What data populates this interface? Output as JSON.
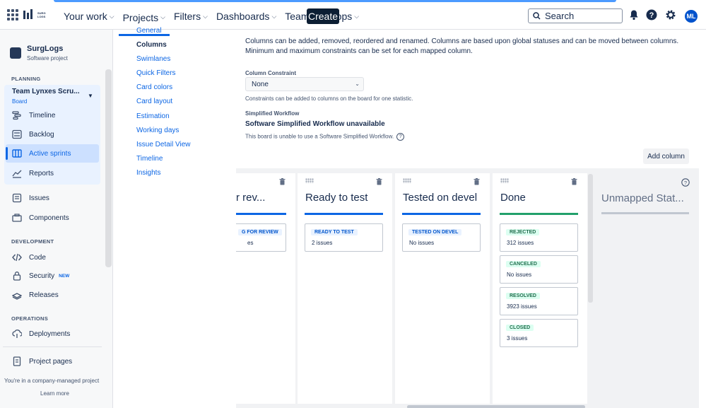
{
  "topnav": {
    "logo_text": "SURG LOGS",
    "items": [
      {
        "label": "Your work"
      },
      {
        "label": "Projects"
      },
      {
        "label": "Filters"
      },
      {
        "label": "Dashboards"
      },
      {
        "label": "Teams"
      },
      {
        "label": "Apps"
      }
    ],
    "create_label": "Create",
    "search_placeholder": "Search",
    "avatar_initials": "ML"
  },
  "sidebar": {
    "project_name": "SurgLogs",
    "project_type": "Software project",
    "planning_heading": "PLANNING",
    "board_name": "Team Lynxes Scru...",
    "board_sub": "Board",
    "planning_items": [
      {
        "label": "Timeline",
        "icon": "timeline-icon"
      },
      {
        "label": "Backlog",
        "icon": "backlog-icon"
      },
      {
        "label": "Active sprints",
        "icon": "board-icon"
      },
      {
        "label": "Reports",
        "icon": "reports-icon"
      }
    ],
    "issues_label": "Issues",
    "components_label": "Components",
    "development_heading": "DEVELOPMENT",
    "code_label": "Code",
    "security_label": "Security",
    "security_badge": "NEW",
    "releases_label": "Releases",
    "operations_heading": "OPERATIONS",
    "deployments_label": "Deployments",
    "project_pages_label": "Project pages",
    "managed_text": "You're in a company-managed project",
    "learn_more": "Learn more"
  },
  "settings_nav": [
    "General",
    "Columns",
    "Swimlanes",
    "Quick Filters",
    "Card colors",
    "Card layout",
    "Estimation",
    "Working days",
    "Issue Detail View",
    "Timeline",
    "Insights"
  ],
  "main": {
    "description": "Columns can be added, removed, reordered and renamed. Columns are based upon global statuses and can be moved between columns. Minimum and maximum constraints can be set for each mapped column.",
    "constraint_label": "Column Constraint",
    "constraint_value": "None",
    "constraint_hint": "Constraints can be added to columns on the board for one statistic.",
    "workflow_label": "Simplified Workflow",
    "workflow_title": "Software Simplified Workflow unavailable",
    "workflow_hint": "This board is unable to use a Software Simplified Workflow.",
    "add_column_label": "Add column"
  },
  "board": {
    "columns": [
      {
        "title": "g for rev...",
        "cards": [
          {
            "status": "G FOR REVIEW",
            "count": "es"
          }
        ]
      },
      {
        "title": "Ready to test",
        "cards": [
          {
            "status": "READY TO TEST",
            "count": "2 issues"
          }
        ]
      },
      {
        "title": "Tested on devel",
        "cards": [
          {
            "status": "TESTED ON DEVEL",
            "count": "No issues"
          }
        ]
      },
      {
        "title": "Done",
        "cards": [
          {
            "status": "REJECTED",
            "count": "312 issues"
          },
          {
            "status": "CANCELED",
            "count": "No issues"
          },
          {
            "status": "RESOLVED",
            "count": "3923 issues"
          },
          {
            "status": "CLOSED",
            "count": "3 issues"
          }
        ]
      }
    ],
    "unmapped_title": "Unmapped Stat..."
  }
}
